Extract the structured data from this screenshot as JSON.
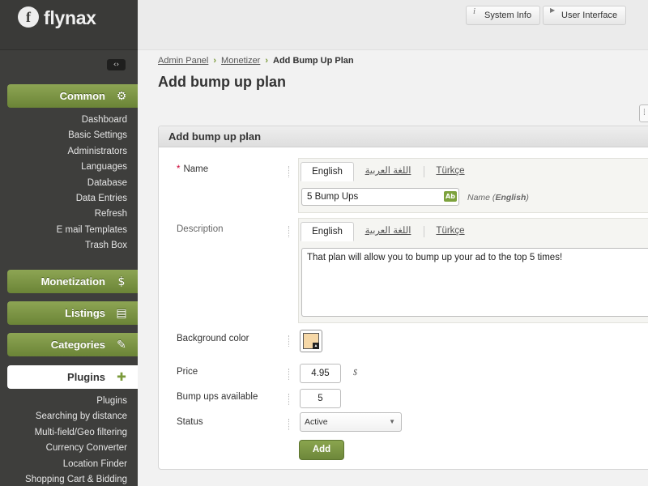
{
  "logo": {
    "mark": "f",
    "text": "flynax"
  },
  "sidebar": {
    "collapse_glyph": "‹›",
    "common": {
      "label": "Common",
      "items": [
        "Dashboard",
        "Basic Settings",
        "Administrators",
        "Languages",
        "Database",
        "Data Entries",
        "Refresh",
        "E mail Templates",
        "Trash Box"
      ]
    },
    "monetization": {
      "label": "Monetization"
    },
    "listings": {
      "label": "Listings"
    },
    "categories": {
      "label": "Categories"
    },
    "plugins": {
      "label": "Plugins",
      "items": [
        "Plugins",
        "Searching by distance",
        "Multi-field/Geo filtering",
        "Currency Converter",
        "Location Finder",
        "Shopping Cart & Bidding"
      ]
    }
  },
  "topbar": {
    "system_info": "System Info",
    "user_interface": "User Interface"
  },
  "breadcrumb": {
    "admin_panel": "Admin Panel",
    "monetizer": "Monetizer",
    "current": "Add Bump Up Plan"
  },
  "page_title": "Add bump up plan",
  "panel": {
    "title": "Add bump up plan",
    "tabs": [
      "English",
      "اللغة العربية",
      "Türkçe"
    ],
    "name": {
      "label": "Name",
      "value": "5 Bump Ups",
      "hint_prefix": "Name (",
      "hint_lang": "English",
      "hint_suffix": ")"
    },
    "description": {
      "label": "Description",
      "value": "That plan will allow you to bump up your ad to the top 5 times!"
    },
    "background_color": {
      "label": "Background color",
      "value": "#f6d8a7"
    },
    "price": {
      "label": "Price",
      "value": "4.95",
      "currency": "$"
    },
    "bumpups": {
      "label": "Bump ups available",
      "value": "5"
    },
    "status": {
      "label": "Status",
      "value": "Active"
    },
    "submit": "Add"
  },
  "colors": {
    "accent": "#6d873a",
    "sidebar_bg": "#3e3e3c"
  }
}
